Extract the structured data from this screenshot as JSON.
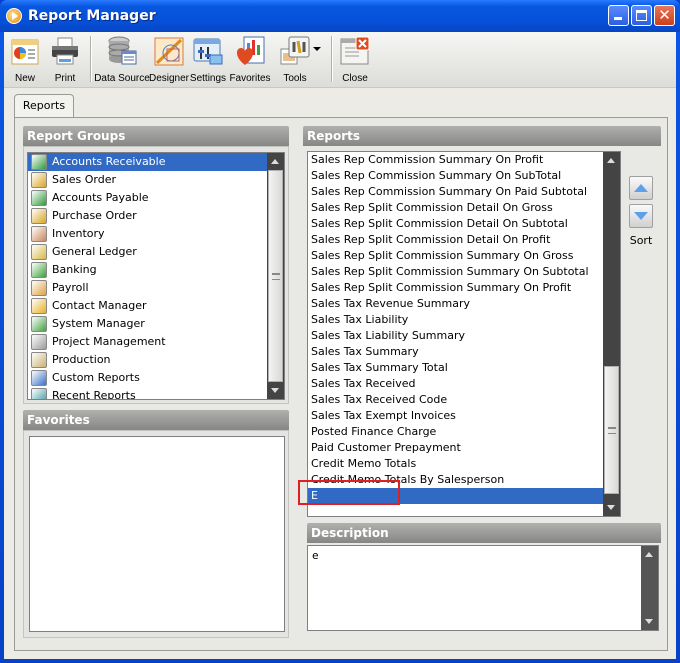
{
  "window": {
    "title": "Report Manager"
  },
  "toolbar": {
    "items": [
      {
        "label": "New",
        "icon": "new-report-icon"
      },
      {
        "label": "Print",
        "icon": "printer-icon"
      },
      {
        "label": "Data Source",
        "icon": "database-icon"
      },
      {
        "label": "Designer",
        "icon": "designer-icon"
      },
      {
        "label": "Settings",
        "icon": "settings-icon"
      },
      {
        "label": "Favorites",
        "icon": "favorites-heart-icon"
      },
      {
        "label": "Tools",
        "icon": "tools-icon"
      },
      {
        "label": "Close",
        "icon": "close-window-icon"
      }
    ]
  },
  "tabs": [
    {
      "label": "Reports",
      "active": true
    }
  ],
  "report_groups": {
    "header": "Report Groups",
    "selected_index": 0,
    "items": [
      {
        "label": "Accounts Receivable",
        "color": "#2e9a3a"
      },
      {
        "label": "Sales Order",
        "color": "#d9a521"
      },
      {
        "label": "Accounts Payable",
        "color": "#2e9a3a"
      },
      {
        "label": "Purchase Order",
        "color": "#d9a521"
      },
      {
        "label": "Inventory",
        "color": "#c9875a"
      },
      {
        "label": "General Ledger",
        "color": "#d8b840"
      },
      {
        "label": "Banking",
        "color": "#3aa03a"
      },
      {
        "label": "Payroll",
        "color": "#e0a040"
      },
      {
        "label": "Contact Manager",
        "color": "#e8b020"
      },
      {
        "label": "System Manager",
        "color": "#40a040"
      },
      {
        "label": "Project Management",
        "color": "#9a9a9a"
      },
      {
        "label": "Production",
        "color": "#c8b070"
      },
      {
        "label": "Custom Reports",
        "color": "#3a70c8"
      },
      {
        "label": "Recent Reports",
        "color": "#3a9aa0"
      }
    ]
  },
  "favorites": {
    "header": "Favorites",
    "items": []
  },
  "reports": {
    "header": "Reports",
    "selected_index": 21,
    "items": [
      "Sales Rep Commission Summary On Profit",
      "Sales Rep Commission Summary On SubTotal",
      "Sales Rep Commission Summary On Paid Subtotal",
      "Sales Rep Split Commission Detail On Gross",
      "Sales Rep Split Commission Detail On Subtotal",
      "Sales Rep Split Commission Detail On Profit",
      "Sales Rep Split Commission Summary On Gross",
      "Sales Rep Split Commission Summary On Subtotal",
      "Sales Rep Split Commission Summary On Profit",
      "Sales Tax Revenue Summary",
      "Sales Tax Liability",
      "Sales Tax Liability Summary",
      "Sales Tax Summary",
      "Sales Tax Summary Total",
      "Sales Tax Received",
      "Sales Tax Received Code",
      "Sales Tax Exempt Invoices",
      "Posted Finance Charge",
      "Paid Customer Prepayment",
      "Credit Memo Totals",
      "Credit Memo Totals By Salesperson",
      "E"
    ]
  },
  "sort": {
    "label": "Sort"
  },
  "description": {
    "header": "Description",
    "text": "e"
  }
}
